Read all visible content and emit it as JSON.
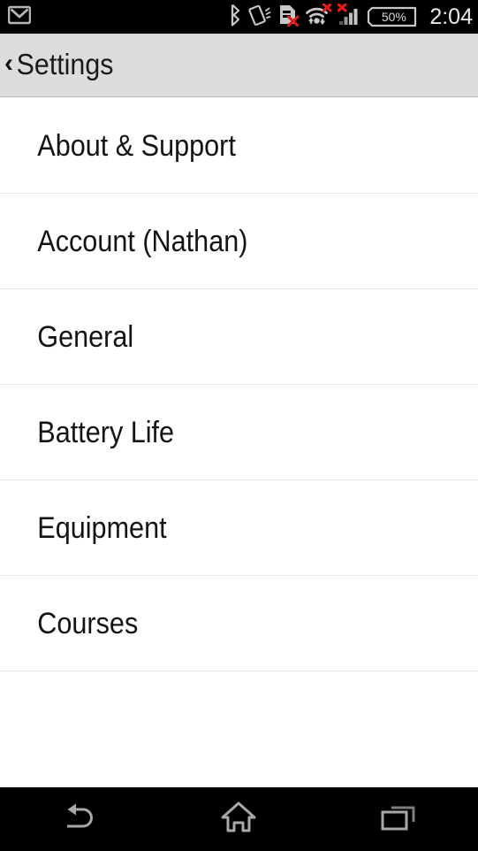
{
  "status_bar": {
    "background": "#000000",
    "notification_icons": [
      {
        "name": "gmail-icon",
        "label": "Gmail"
      }
    ],
    "system_icons": [
      {
        "name": "bluetooth-icon",
        "label": "Bluetooth"
      },
      {
        "name": "vibrate-icon",
        "label": "Vibrate"
      },
      {
        "name": "sim-card-disabled-icon",
        "label": "SIM card unavailable"
      },
      {
        "name": "wifi-disconnected-icon",
        "label": "Wi-Fi no connection"
      },
      {
        "name": "cellular-signal-disabled-icon",
        "label": "Mobile signal no service"
      }
    ],
    "battery": {
      "level_label": "50%",
      "level_percent": 50
    },
    "clock": "2:04"
  },
  "title_bar": {
    "back_chevron": "‹",
    "title": "Settings",
    "background": "#dcdcdc",
    "text_color": "#1a1a1a"
  },
  "settings_list": {
    "background": "#ffffff",
    "divider_color": "#e6e6e6",
    "items": [
      {
        "label": "About & Support",
        "name": "settings-item-about-support"
      },
      {
        "label": "Account (Nathan)",
        "name": "settings-item-account"
      },
      {
        "label": "General",
        "name": "settings-item-general"
      },
      {
        "label": "Battery Life",
        "name": "settings-item-battery-life"
      },
      {
        "label": "Equipment",
        "name": "settings-item-equipment"
      },
      {
        "label": "Courses",
        "name": "settings-item-courses"
      }
    ]
  },
  "nav_bar": {
    "background": "#000000",
    "icon_color": "#a8a8a8",
    "buttons": [
      {
        "name": "nav-back-button",
        "label": "Back"
      },
      {
        "name": "nav-home-button",
        "label": "Home"
      },
      {
        "name": "nav-recents-button",
        "label": "Recent apps"
      }
    ]
  }
}
